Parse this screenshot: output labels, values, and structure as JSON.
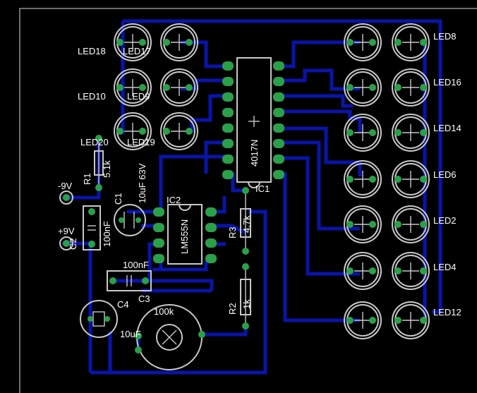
{
  "colors": {
    "background": "#000000",
    "trace": "#0a14a8",
    "pad": "#2aa04a",
    "outline": "#c8c8c8",
    "text": "#ffffff"
  },
  "ic1": {
    "name": "IC1",
    "value": "4017N"
  },
  "ic2": {
    "name": "IC2",
    "value": "LM555N"
  },
  "r1": {
    "name": "R1",
    "value": "5.1k"
  },
  "r2": {
    "name": "R2",
    "value": "1k"
  },
  "r3": {
    "name": "R3",
    "value": "4.7k"
  },
  "c1": {
    "name": "C1",
    "value": "10uF 63V"
  },
  "c2": {
    "name": "C2",
    "value": "100nF"
  },
  "c3": {
    "name": "C3",
    "value": "100nF"
  },
  "c4": {
    "name": "C4",
    "value": "10uF"
  },
  "pot": {
    "value": "100k"
  },
  "power": {
    "neg": "-9V",
    "pos": "+9V"
  },
  "leds": {
    "left": [
      "LED18",
      "LED17",
      "LED10",
      "LED9",
      "LED20",
      "LED19"
    ],
    "right": [
      "LED8",
      "LED16",
      "LED14",
      "LED6",
      "LED2",
      "LED4",
      "LED12"
    ]
  }
}
